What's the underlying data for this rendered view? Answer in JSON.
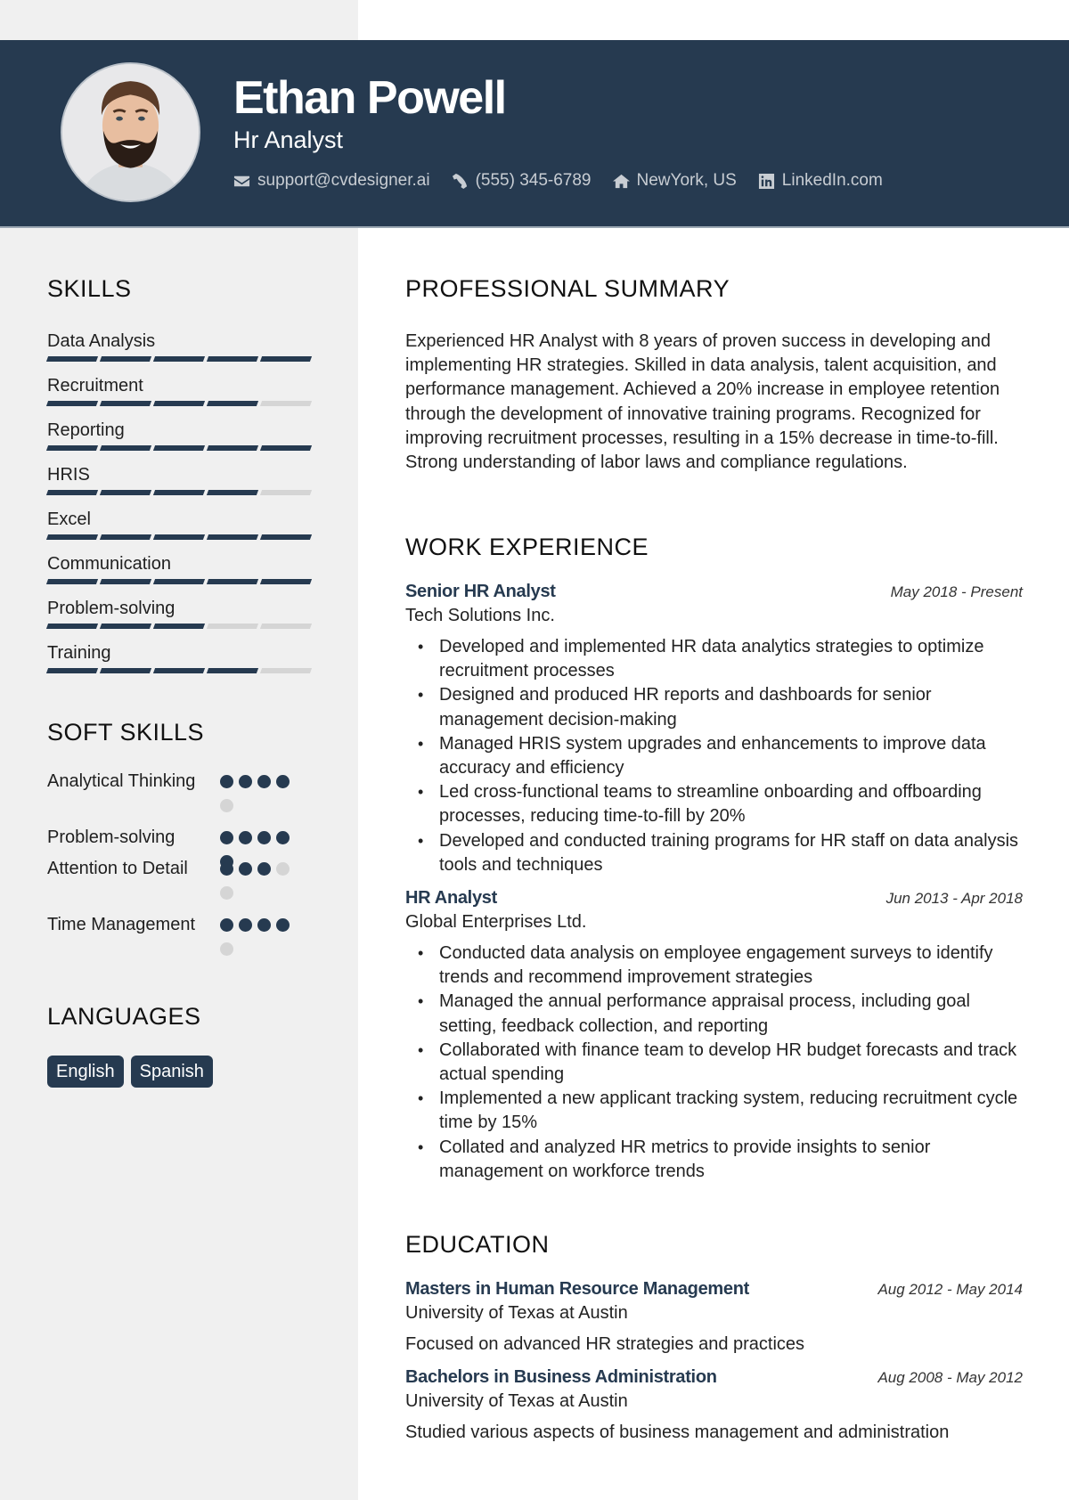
{
  "header": {
    "name": "Ethan Powell",
    "role": "Hr Analyst",
    "contacts": [
      {
        "icon": "envelope-icon",
        "text": "support@cvdesigner.ai"
      },
      {
        "icon": "phone-icon",
        "text": "(555) 345-6789"
      },
      {
        "icon": "home-icon",
        "text": "NewYork, US"
      },
      {
        "icon": "linkedin-icon",
        "text": "LinkedIn.com"
      }
    ]
  },
  "colors": {
    "accent": "#263a50",
    "sidebar": "#f0f0f0",
    "inactive": "#d5d5d5"
  },
  "sidebar": {
    "skills_title": "SKILLS",
    "skills": [
      {
        "name": "Data Analysis",
        "level": 5,
        "max": 5
      },
      {
        "name": "Recruitment",
        "level": 4,
        "max": 5
      },
      {
        "name": "Reporting",
        "level": 5,
        "max": 5
      },
      {
        "name": "HRIS",
        "level": 4,
        "max": 5
      },
      {
        "name": "Excel",
        "level": 5,
        "max": 5
      },
      {
        "name": "Communication",
        "level": 5,
        "max": 5
      },
      {
        "name": "Problem-solving",
        "level": 3,
        "max": 5
      },
      {
        "name": "Training",
        "level": 4,
        "max": 5
      }
    ],
    "soft_skills_title": "SOFT SKILLS",
    "soft_skills": [
      {
        "name": "Analytical Thinking",
        "level": 4,
        "max": 5
      },
      {
        "name": "Problem-solving",
        "level": 5,
        "max": 5
      },
      {
        "name": "Attention to Detail",
        "level": 3,
        "max": 5
      },
      {
        "name": "Time Management",
        "level": 4,
        "max": 5
      }
    ],
    "languages_title": "LANGUAGES",
    "languages": [
      "English",
      "Spanish"
    ]
  },
  "main": {
    "summary_title": "PROFESSIONAL SUMMARY",
    "summary": "Experienced HR Analyst with 8 years of proven success in developing and implementing HR strategies. Skilled in data analysis, talent acquisition, and performance management. Achieved a 20% increase in employee retention through the development of innovative training programs. Recognized for improving recruitment processes, resulting in a 15% decrease in time-to-fill. Strong understanding of labor laws and compliance regulations.",
    "experience_title": "WORK EXPERIENCE",
    "experience": [
      {
        "title": "Senior HR Analyst",
        "date": "May 2018 - Present",
        "company": "Tech Solutions Inc.",
        "bullets": [
          "Developed and implemented HR data analytics strategies to optimize recruitment processes",
          "Designed and produced HR reports and dashboards for senior management decision-making",
          "Managed HRIS system upgrades and enhancements to improve data accuracy and efficiency",
          "Led cross-functional teams to streamline onboarding and offboarding processes, reducing time-to-fill by 20%",
          "Developed and conducted training programs for HR staff on data analysis tools and techniques"
        ]
      },
      {
        "title": "HR Analyst",
        "date": "Jun 2013 - Apr 2018",
        "company": "Global Enterprises Ltd.",
        "bullets": [
          "Conducted data analysis on employee engagement surveys to identify trends and recommend improvement strategies",
          "Managed the annual performance appraisal process, including goal setting, feedback collection, and reporting",
          "Collaborated with finance team to develop HR budget forecasts and track actual spending",
          "Implemented a new applicant tracking system, reducing recruitment cycle time by 15%",
          "Collated and analyzed HR metrics to provide insights to senior management on workforce trends"
        ]
      }
    ],
    "education_title": "EDUCATION",
    "education": [
      {
        "degree": "Masters in Human Resource Management",
        "date": "Aug 2012 - May 2014",
        "school": "University of Texas at Austin",
        "description": "Focused on advanced HR strategies and practices"
      },
      {
        "degree": "Bachelors in Business Administration",
        "date": "Aug 2008 - May 2012",
        "school": "University of Texas at Austin",
        "description": "Studied various aspects of business management and administration"
      }
    ]
  }
}
